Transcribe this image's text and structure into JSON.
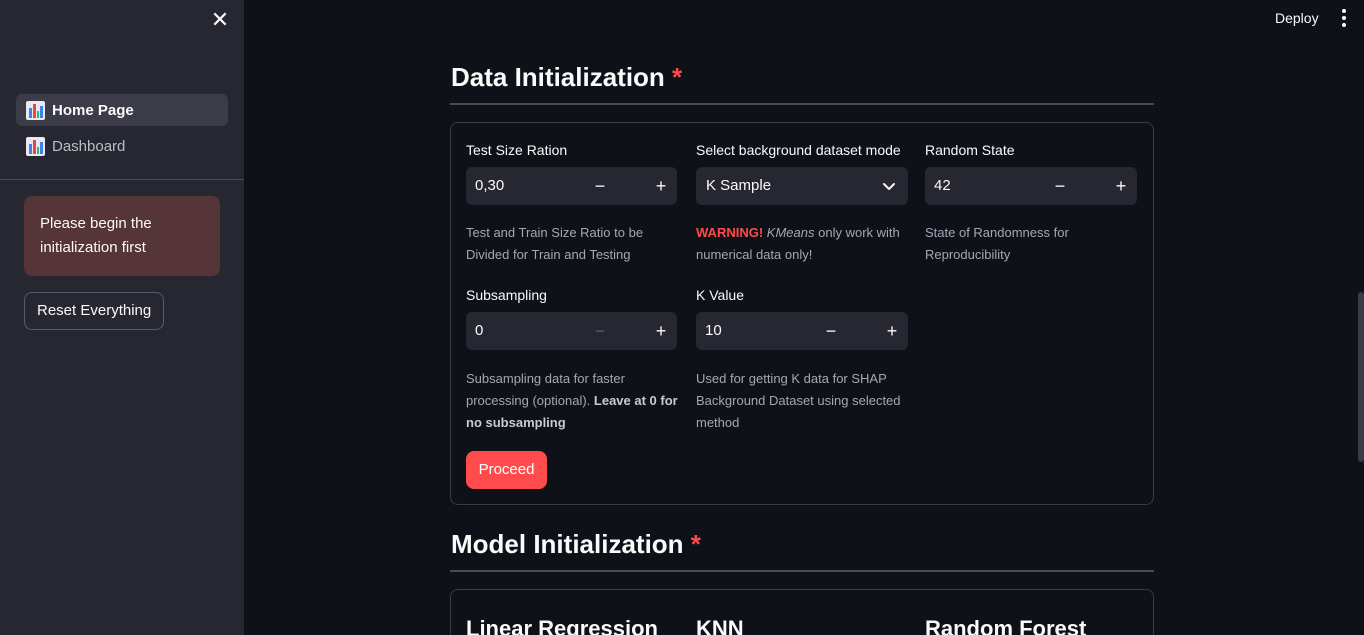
{
  "header": {
    "deploy_label": "Deploy"
  },
  "sidebar": {
    "items": [
      {
        "label": "Home Page",
        "active": true
      },
      {
        "label": "Dashboard",
        "active": false
      }
    ],
    "alert_text": "Please begin the initialization first",
    "reset_label": "Reset Everything"
  },
  "data_init": {
    "title": "Data Initialization",
    "required_mark": "*",
    "test_size": {
      "label": "Test Size Ration",
      "value": "0,30",
      "help": "Test and Train Size Ratio to be Divided for Train and Testing"
    },
    "bg_mode": {
      "label": "Select background dataset mode",
      "value": "K Sample",
      "help_warning": "WARNING!",
      "help_em": "KMeans",
      "help_rest": " only work with numerical data only!"
    },
    "random_state": {
      "label": "Random State",
      "value": "42",
      "help": "State of Randomness for Reproducibility"
    },
    "subsampling": {
      "label": "Subsampling",
      "value": "0",
      "help_plain": "Subsampling data for faster processing (optional). ",
      "help_bold": "Leave at 0 for no subsampling"
    },
    "k_value": {
      "label": "K Value",
      "value": "10",
      "help": "Used for getting K data for SHAP Background Dataset using selected method"
    },
    "proceed_label": "Proceed"
  },
  "model_init": {
    "title": "Model Initialization",
    "required_mark": "*",
    "columns": [
      "Linear Regression",
      "KNN",
      "Random Forest"
    ]
  },
  "icons": {
    "close": "close-icon",
    "more": "more-vertical-icon",
    "nav": "bar-chart-icon",
    "minus": "minus-icon",
    "plus": "plus-icon",
    "select": "chevron-down-icon"
  },
  "colors": {
    "accent": "#ff4b4b",
    "background": "#0e1117",
    "sidebar": "#262730"
  }
}
